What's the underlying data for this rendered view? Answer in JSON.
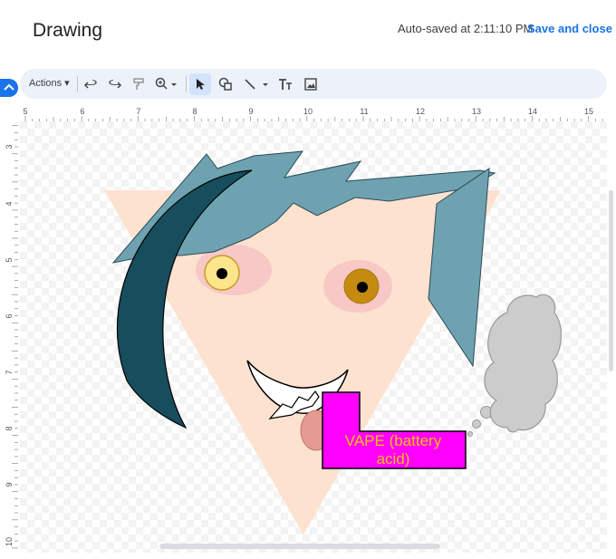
{
  "header": {
    "title": "Drawing",
    "autosave": "Auto-saved at 2:11:10 PM",
    "save_close": "Save and close"
  },
  "toolbar": {
    "actions_label": "Actions",
    "icons": [
      "undo-icon",
      "redo-icon",
      "paint-format-icon",
      "zoom-icon",
      "select-icon",
      "shape-icon",
      "line-icon",
      "text-box-icon",
      "image-icon"
    ]
  },
  "ruler": {
    "horizontal": [
      "5",
      "6",
      "7",
      "8",
      "9",
      "10",
      "11",
      "12",
      "13",
      "14",
      "15"
    ],
    "vertical": [
      "3",
      "4",
      "5",
      "6",
      "7",
      "8",
      "9",
      "10"
    ]
  },
  "drawing": {
    "text_box": "VAPE (battery acid)",
    "text_line1": "VAPE (battery",
    "text_line2": "acid)",
    "colors": {
      "face": "#fde2cf",
      "hair": "#6fa2b1",
      "dark_crescent": "#174e5d",
      "cheek": "#f7c8c6",
      "left_eye": "#fce58a",
      "right_eye": "#c48b10",
      "text_box": "#ff00ff",
      "text": "#f4c20d",
      "tongue": "#e59a92",
      "smoke": "#cccccc"
    }
  }
}
